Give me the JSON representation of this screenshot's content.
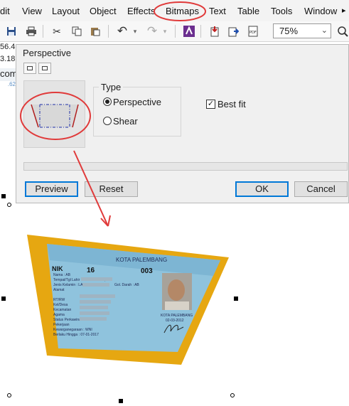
{
  "menubar": {
    "items": [
      "dit",
      "View",
      "Layout",
      "Object",
      "Effects",
      "Bitmaps",
      "Text",
      "Table",
      "Tools",
      "Window"
    ]
  },
  "toolbar": {
    "zoom_value": "75%",
    "icons": [
      "save-icon",
      "print-icon",
      "cut-icon",
      "copy-icon",
      "paste-icon",
      "undo-icon",
      "redo-icon",
      "launch-icon",
      "import-icon",
      "export-icon",
      "pdf-icon"
    ]
  },
  "left_strip": {
    "coord1": "56.4",
    "coord2": "3.18",
    "label": "com",
    "ruler": ".62"
  },
  "dialog": {
    "title": "Perspective",
    "type_label": "Type",
    "options": [
      "Perspective",
      "Shear"
    ],
    "selected": "Perspective",
    "best_fit_label": "Best fit",
    "best_fit_checked": true,
    "buttons": {
      "preview": "Preview",
      "reset": "Reset",
      "ok": "OK",
      "cancel": "Cancel"
    }
  },
  "id_card": {
    "header": "KOTA PALEMBANG",
    "nik_label": "NIK",
    "nik_start": "16",
    "nik_end": "003",
    "fields": [
      {
        "label": "Nama",
        "value": ": AB"
      },
      {
        "label": "Tempat/Tgl Lahir",
        "value": ": PALEMBANG,"
      },
      {
        "label": "Jenis Kelamin",
        "value": ": LAKI-LAKI"
      },
      {
        "label": "Alamat",
        "value": ""
      },
      {
        "label": "RT/RW",
        "value": ""
      },
      {
        "label": "Kel/Desa",
        "value": ""
      },
      {
        "label": "Kecamatan",
        "value": ""
      },
      {
        "label": "Agama",
        "value": ""
      },
      {
        "label": "Status Perkawinan",
        "value": ""
      },
      {
        "label": "Pekerjaan",
        "value": ""
      },
      {
        "label": "Kewarganegaraan",
        "value": ": WNI"
      },
      {
        "label": "Berlaku Hingga",
        "value": ": 07-01-2017"
      }
    ],
    "blood_type": "Gol. Darah : AB",
    "issue_city": "KOTA PALEMBANG",
    "issue_date": "02-03-2012"
  },
  "colors": {
    "annotation_red": "#e03a3a",
    "card_blue": "#8fc3dd",
    "card_bg_yellow": "#e6a711",
    "focus_blue": "#0078d7"
  }
}
